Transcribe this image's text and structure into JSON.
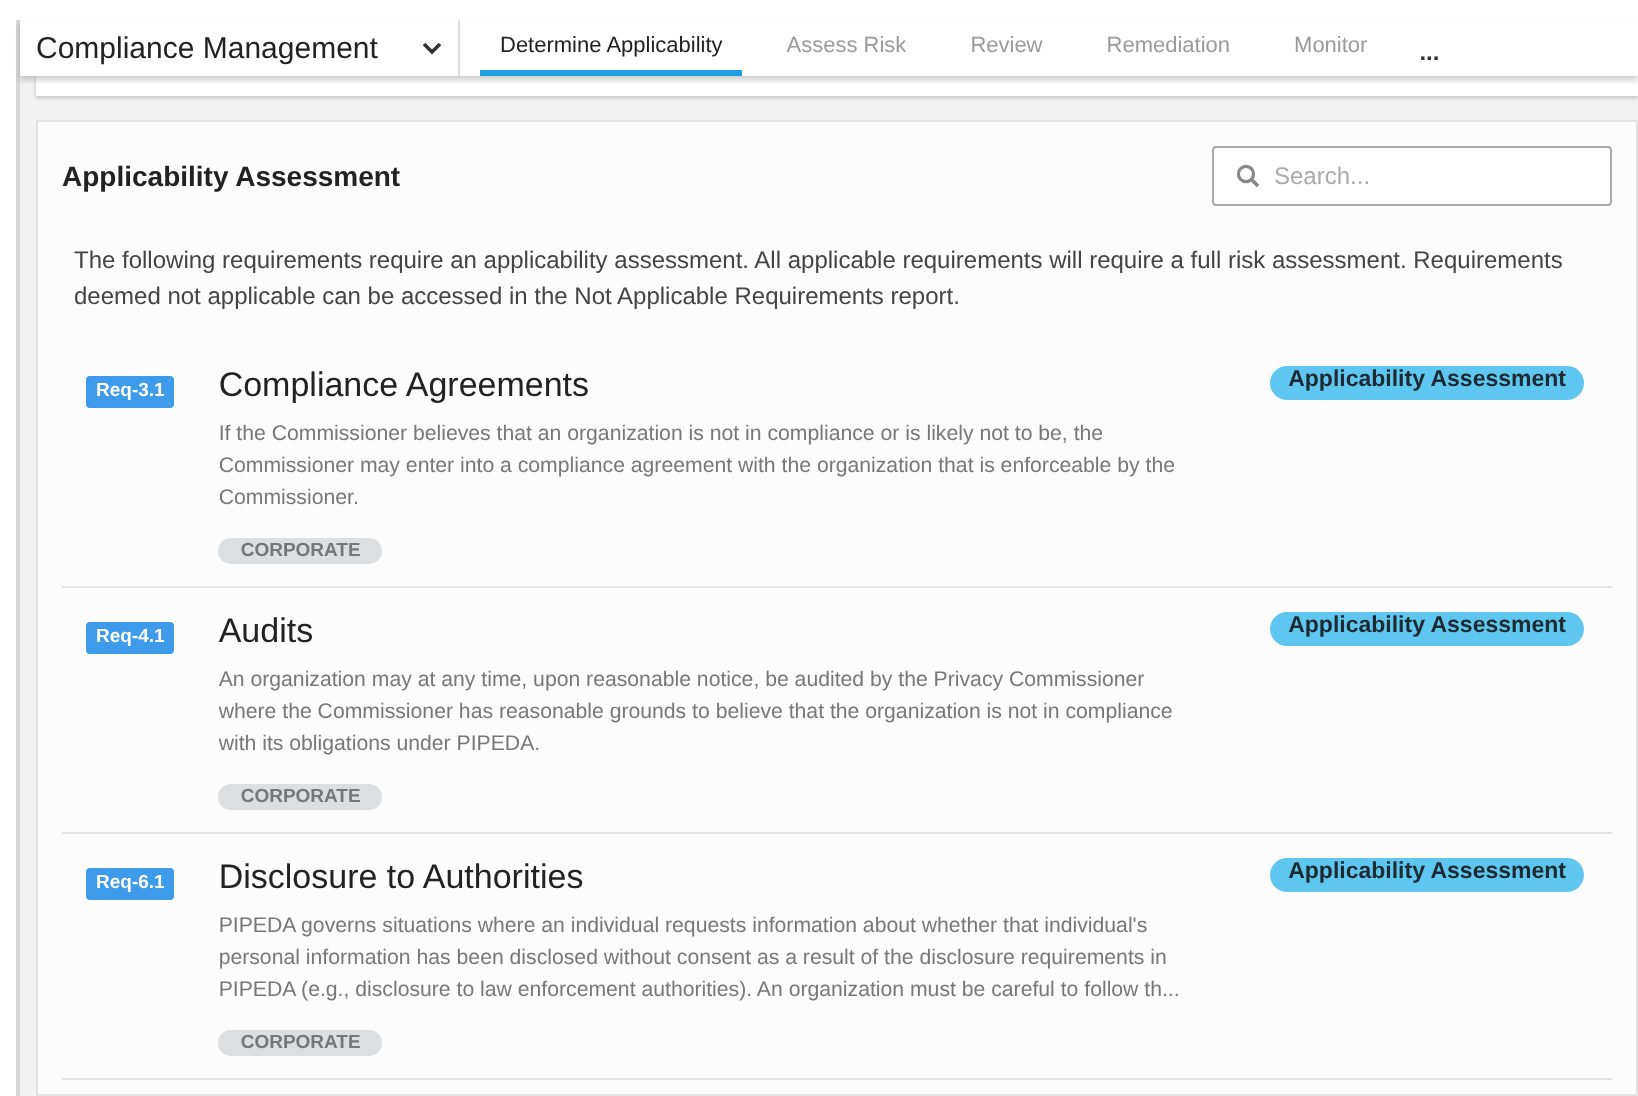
{
  "header": {
    "module": "Compliance Management",
    "tabs": [
      {
        "label": "Determine Applicability",
        "selected": true
      },
      {
        "label": "Assess Risk",
        "selected": false
      },
      {
        "label": "Review",
        "selected": false
      },
      {
        "label": "Remediation",
        "selected": false
      },
      {
        "label": "Monitor",
        "selected": false
      }
    ],
    "more": "..."
  },
  "panel": {
    "title": "Applicability Assessment",
    "search": {
      "placeholder": "Search..."
    },
    "intro": "The following requirements require an applicability assessment. All applicable requirements will require a full risk assessment. Requirements deemed not applicable can be accessed in the Not Applicable Requirements report."
  },
  "requirements": [
    {
      "id": "Req-3.1",
      "title": "Compliance Agreements",
      "description": "If the Commissioner believes that an organization is not in compliance or is likely not to be, the Commissioner may enter into a compliance agreement with the organization that is enforceable by the Commissioner.",
      "tag": "CORPORATE",
      "status": "Applicability Assessment"
    },
    {
      "id": "Req-4.1",
      "title": "Audits",
      "description": "An organization may at any time, upon reasonable notice, be audited by the Privacy Commissioner where the Commissioner has reasonable grounds to believe that the organization is not in compliance with its obligations under PIPEDA.",
      "tag": "CORPORATE",
      "status": "Applicability Assessment"
    },
    {
      "id": "Req-6.1",
      "title": "Disclosure to Authorities",
      "description": "PIPEDA governs situations where an individual requests information about whether that individual's personal information has been disclosed without consent as a result of the disclosure requirements in PIPEDA (e.g., disclosure to law enforcement authorities). An organization must be careful to follow th...",
      "tag": "CORPORATE",
      "status": "Applicability Assessment"
    }
  ]
}
